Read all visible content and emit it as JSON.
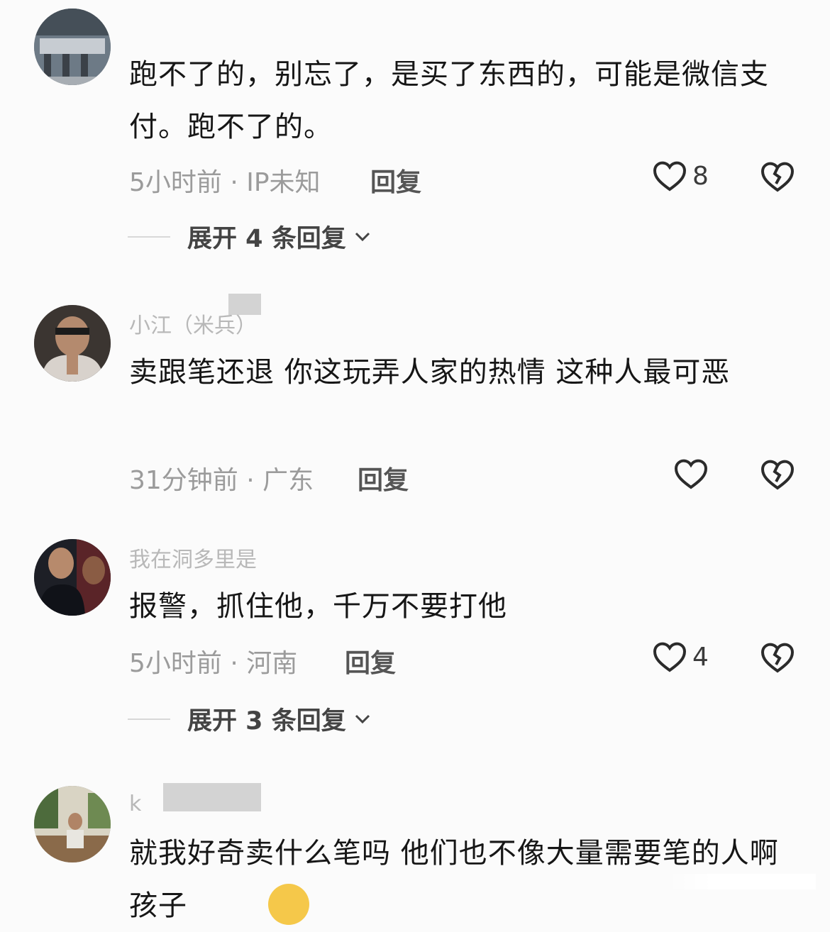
{
  "comments": [
    {
      "username": "",
      "text": "跑不了的，别忘了，是买了东西的，可能是微信支付。跑不了的。",
      "meta": "5小时前 · IP未知",
      "reply_label": "回复",
      "like_count": "8",
      "expand_label": "展开 4 条回复"
    },
    {
      "username": "小江（米兵）",
      "text": "卖跟笔还退  你这玩弄人家的热情  这种人最可恶",
      "meta": "31分钟前 · 广东",
      "reply_label": "回复",
      "like_count": ""
    },
    {
      "username": "我在洞多里是",
      "text": "报警，抓住他，千万不要打他",
      "meta": "5小时前 · 河南",
      "reply_label": "回复",
      "like_count": "4",
      "expand_label": "展开 3 条回复"
    },
    {
      "username": "k",
      "text": "就我好奇卖什么笔吗 他们也不像大量需要笔的人啊 孩子",
      "meta": "",
      "reply_label": "",
      "like_count": ""
    }
  ],
  "icons": {
    "like": "heart-outline-icon",
    "dislike": "broken-heart-icon",
    "expand": "chevron-down-icon",
    "emoji": "grinning-face-emoji"
  },
  "colors": {
    "background": "#fbfbfb",
    "text": "#161616",
    "meta": "#9b9b9b",
    "reply": "#555555"
  }
}
